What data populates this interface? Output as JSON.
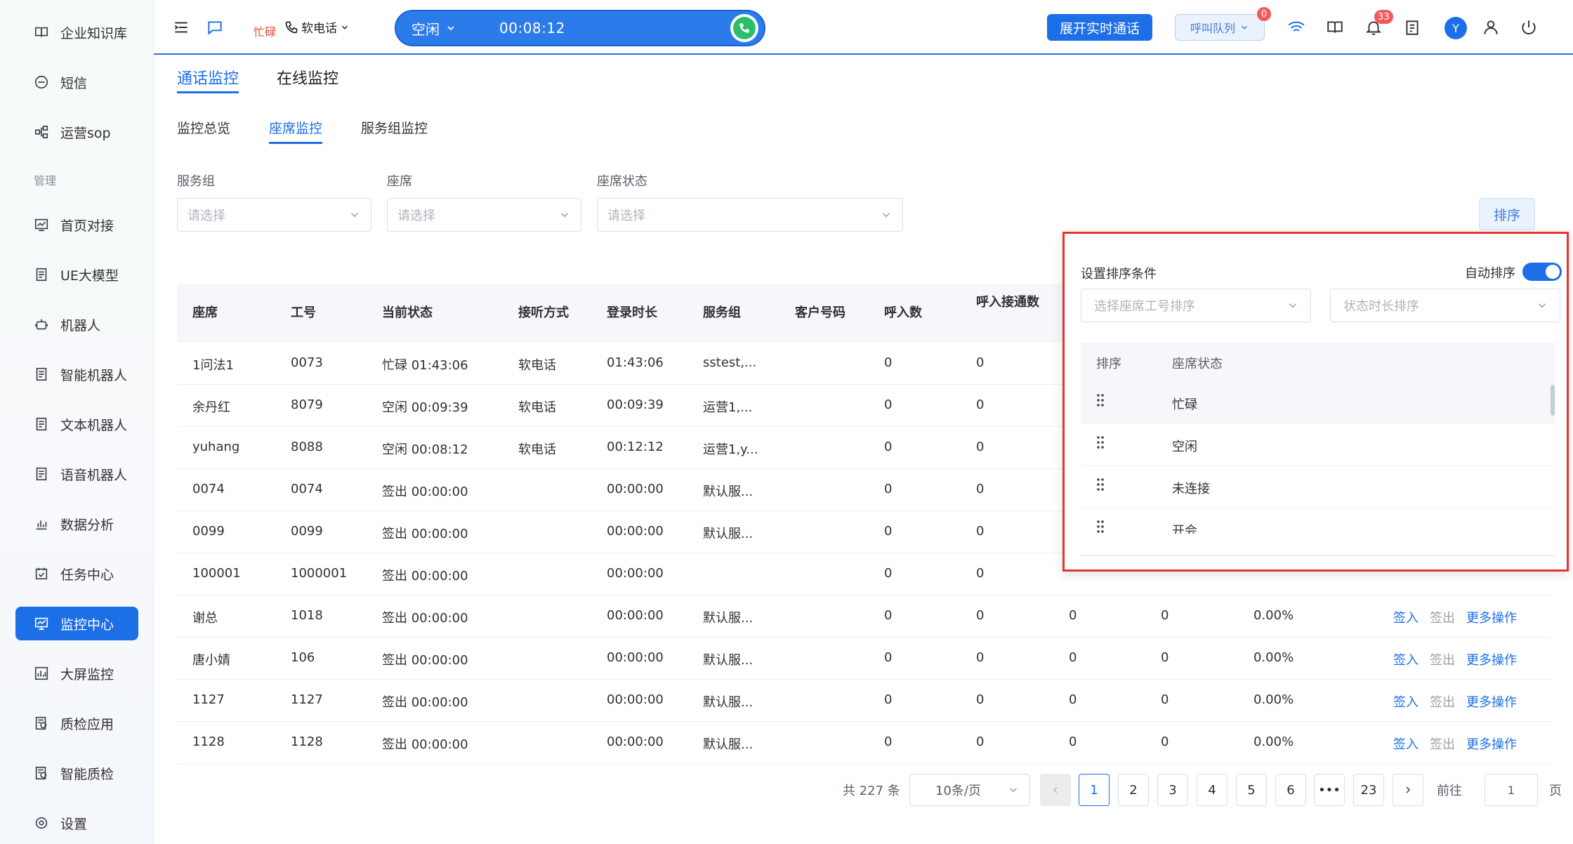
{
  "sidebar": {
    "items_top": [
      {
        "label": "企业知识库",
        "icon": "book-icon"
      },
      {
        "label": "短信",
        "icon": "sms-icon"
      },
      {
        "label": "运营sop",
        "icon": "flow-icon"
      }
    ],
    "section_label": "管理",
    "items": [
      {
        "label": "首页对接",
        "icon": "chart-icon"
      },
      {
        "label": "UE大模型",
        "icon": "doc-icon"
      },
      {
        "label": "机器人",
        "icon": "robot-icon"
      },
      {
        "label": "智能机器人",
        "icon": "doc-icon"
      },
      {
        "label": "文本机器人",
        "icon": "doc-icon"
      },
      {
        "label": "语音机器人",
        "icon": "doc-icon"
      },
      {
        "label": "数据分析",
        "icon": "bar-chart-icon"
      },
      {
        "label": "任务中心",
        "icon": "calendar-check-icon"
      },
      {
        "label": "监控中心",
        "icon": "monitor-icon",
        "active": true
      },
      {
        "label": "大屏监控",
        "icon": "bar-chart-icon"
      },
      {
        "label": "质检应用",
        "icon": "check-doc-icon"
      },
      {
        "label": "智能质检",
        "icon": "check-doc-icon"
      },
      {
        "label": "设置",
        "icon": "gear-icon"
      }
    ]
  },
  "topbar": {
    "busy_label": "忙碌",
    "phone_mode": "软电话",
    "status": "空闲",
    "timer": "00:08:12",
    "expand_button": "展开实时通话",
    "queue_button": "呼叫队列",
    "queue_badge": "0",
    "notification_badge": "33",
    "avatar_letter": "Y"
  },
  "tabs": [
    "通话监控",
    "在线监控"
  ],
  "subtabs": [
    "监控总览",
    "座席监控",
    "服务组监控"
  ],
  "filters": [
    {
      "label": "服务组",
      "placeholder": "请选择"
    },
    {
      "label": "座席",
      "placeholder": "请选择"
    },
    {
      "label": "座席状态",
      "placeholder": "请选择"
    }
  ],
  "sort_button": "排序",
  "table": {
    "headers": [
      "座席",
      "工号",
      "当前状态",
      "接听方式",
      "登录时长",
      "服务组",
      "客户号码",
      "呼入数",
      "呼入接通数"
    ],
    "rows": [
      {
        "agent": "1问法1",
        "id": "0073",
        "status": "忙碌 01:43:06",
        "mode": "软电话",
        "login": "01:43:06",
        "group": "sstest,...",
        "phone": "",
        "inbound": "0",
        "connected": "0",
        "c10": "",
        "c11": "",
        "c12": "",
        "actions": false
      },
      {
        "agent": "余丹红",
        "id": "8079",
        "status": "空闲 00:09:39",
        "mode": "软电话",
        "login": "00:09:39",
        "group": "运营1,...",
        "phone": "",
        "inbound": "0",
        "connected": "0",
        "c10": "",
        "c11": "",
        "c12": "",
        "actions": false
      },
      {
        "agent": "yuhang",
        "id": "8088",
        "status": "空闲 00:08:12",
        "mode": "软电话",
        "login": "00:12:12",
        "group": "运营1,y...",
        "phone": "",
        "inbound": "0",
        "connected": "0",
        "c10": "",
        "c11": "",
        "c12": "",
        "actions": false
      },
      {
        "agent": "0074",
        "id": "0074",
        "status": "签出 00:00:00",
        "mode": "",
        "login": "00:00:00",
        "group": "默认服...",
        "phone": "",
        "inbound": "0",
        "connected": "0",
        "c10": "",
        "c11": "",
        "c12": "",
        "actions": false
      },
      {
        "agent": "0099",
        "id": "0099",
        "status": "签出 00:00:00",
        "mode": "",
        "login": "00:00:00",
        "group": "默认服...",
        "phone": "",
        "inbound": "0",
        "connected": "0",
        "c10": "",
        "c11": "",
        "c12": "",
        "actions": false
      },
      {
        "agent": "100001",
        "id": "1000001",
        "status": "签出 00:00:00",
        "mode": "",
        "login": "00:00:00",
        "group": "",
        "phone": "",
        "inbound": "0",
        "connected": "0",
        "c10": "",
        "c11": "",
        "c12": "",
        "actions": false
      },
      {
        "agent": "谢总",
        "id": "1018",
        "status": "签出 00:00:00",
        "mode": "",
        "login": "00:00:00",
        "group": "默认服...",
        "phone": "",
        "inbound": "0",
        "connected": "0",
        "c10": "0",
        "c11": "0",
        "c12": "0.00%",
        "actions": true
      },
      {
        "agent": "唐小婧",
        "id": "106",
        "status": "签出 00:00:00",
        "mode": "",
        "login": "00:00:00",
        "group": "默认服...",
        "phone": "",
        "inbound": "0",
        "connected": "0",
        "c10": "0",
        "c11": "0",
        "c12": "0.00%",
        "actions": true
      },
      {
        "agent": "1127",
        "id": "1127",
        "status": "签出 00:00:00",
        "mode": "",
        "login": "00:00:00",
        "group": "默认服...",
        "phone": "",
        "inbound": "0",
        "connected": "0",
        "c10": "0",
        "c11": "0",
        "c12": "0.00%",
        "actions": true
      },
      {
        "agent": "1128",
        "id": "1128",
        "status": "签出 00:00:00",
        "mode": "",
        "login": "00:00:00",
        "group": "默认服...",
        "phone": "",
        "inbound": "0",
        "connected": "0",
        "c10": "0",
        "c11": "0",
        "c12": "0.00%",
        "actions": true
      }
    ],
    "actions": {
      "sign_in": "签入",
      "sign_out": "签出",
      "more": "更多操作"
    }
  },
  "pagination": {
    "total": "共 227 条",
    "page_size": "10条/页",
    "pages": [
      "1",
      "2",
      "3",
      "4",
      "5",
      "6",
      "•••",
      "23"
    ],
    "current": "1",
    "goto_label": "前往",
    "goto_value": "1",
    "page_suffix": "页"
  },
  "sort_popover": {
    "title": "设置排序条件",
    "auto_sort_label": "自动排序",
    "auto_sort_on": true,
    "select_agent_placeholder": "选择座席工号排序",
    "select_duration_placeholder": "状态时长排序",
    "col_order": "排序",
    "col_status": "座席状态",
    "statuses": [
      "忙碌",
      "空闲",
      "未连接",
      "开会"
    ]
  },
  "colors": {
    "primary": "#1d6fe8",
    "busy": "#e8493b",
    "call_green": "#2dbe6a",
    "popover_border": "#e5342f"
  }
}
